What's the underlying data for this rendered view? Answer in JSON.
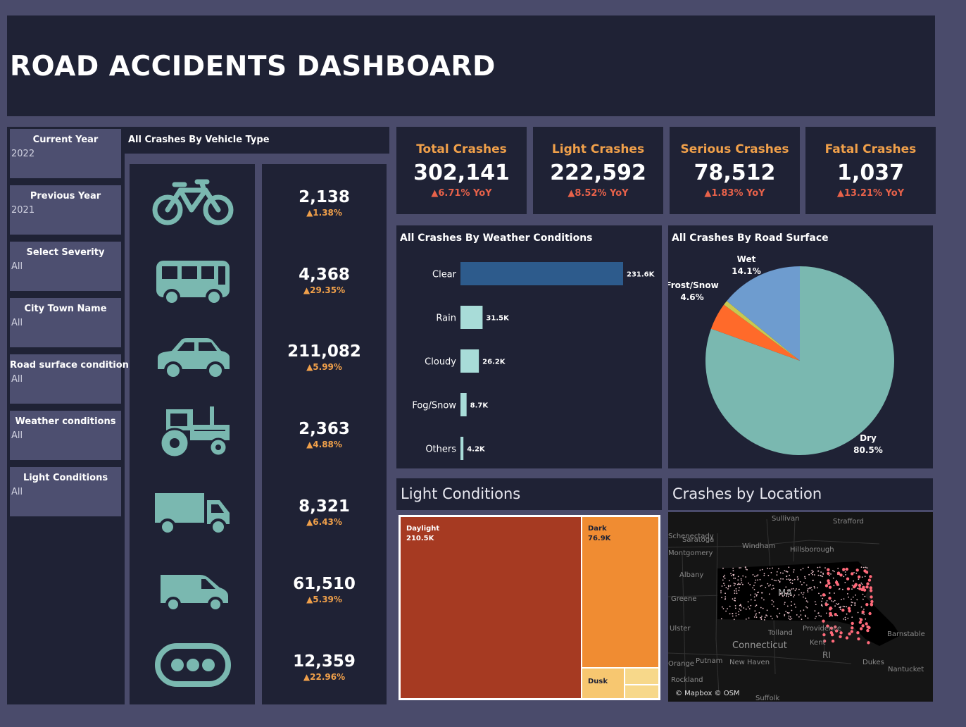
{
  "header": {
    "title": "ROAD ACCIDENTS DASHBOARD"
  },
  "filters": [
    {
      "label": "Current Year",
      "value": "2022"
    },
    {
      "label": "Previous Year",
      "value": "2021"
    },
    {
      "label": "Select Severity",
      "value": "All"
    },
    {
      "label": "City Town Name",
      "value": "All"
    },
    {
      "label": "Road surface condition",
      "value": "All"
    },
    {
      "label": "Weather conditions",
      "value": "All"
    },
    {
      "label": "Light Conditions",
      "value": "All"
    }
  ],
  "vehicle_section": {
    "title": "All Crashes By Vehicle Type",
    "items": [
      {
        "icon": "bicycle-icon",
        "value": "2,138",
        "change": "▲1.38%"
      },
      {
        "icon": "bus-icon",
        "value": "4,368",
        "change": "▲29.35%"
      },
      {
        "icon": "car-icon",
        "value": "211,082",
        "change": "▲5.99%"
      },
      {
        "icon": "tractor-icon",
        "value": "2,363",
        "change": "▲4.88%"
      },
      {
        "icon": "truck-icon",
        "value": "8,321",
        "change": "▲6.43%"
      },
      {
        "icon": "van-icon",
        "value": "61,510",
        "change": "▲5.39%"
      },
      {
        "icon": "others-icon",
        "value": "12,359",
        "change": "▲22.96%"
      }
    ]
  },
  "kpis": [
    {
      "label": "Total Crashes",
      "value": "302,141",
      "change": "▲6.71% YoY"
    },
    {
      "label": "Light Crashes",
      "value": "222,592",
      "change": "▲8.52% YoY"
    },
    {
      "label": "Serious Crashes",
      "value": "78,512",
      "change": "▲1.83% YoY"
    },
    {
      "label": "Fatal Crashes",
      "value": "1,037",
      "change": "▲13.21% YoY"
    }
  ],
  "colors": {
    "background": "#4a4b6b",
    "panel": "#1f2235",
    "accent_orange": "#f0a04a",
    "change_red": "#e8624a",
    "teal": "#7ab8b0"
  },
  "chart_data": [
    {
      "type": "bar",
      "title": "All Crashes By Weather Conditions",
      "orientation": "horizontal",
      "categories": [
        "Clear",
        "Rain",
        "Cloudy",
        "Fog/Snow",
        "Others"
      ],
      "values": [
        231600,
        31500,
        26200,
        8700,
        4200
      ],
      "labels": [
        "231.6K",
        "31.5K",
        "26.2K",
        "8.7K",
        "4.2K"
      ],
      "colors": [
        "#2d5b8c",
        "#a8dcd8",
        "#a8dcd8",
        "#a8dcd8",
        "#a8dcd8"
      ],
      "xlim": [
        0,
        231600
      ]
    },
    {
      "type": "pie",
      "title": "All Crashes By Road Surface",
      "slices": [
        {
          "label": "Dry",
          "value": 80.5,
          "label_text": "80.5%",
          "color": "#7ab8b0"
        },
        {
          "label": "Frost/Snow",
          "value": 4.6,
          "label_text": "4.6%",
          "color": "#ff6a2a"
        },
        {
          "label": "",
          "value": 0.8,
          "label_text": "",
          "color": "#c8c850"
        },
        {
          "label": "Wet",
          "value": 14.1,
          "label_text": "14.1%",
          "color": "#6e9ccf"
        }
      ]
    },
    {
      "type": "treemap",
      "title": "Light Conditions",
      "items": [
        {
          "label": "Daylight",
          "value_label": "210.5K",
          "value": 210500,
          "color": "#a63a22"
        },
        {
          "label": "Dark",
          "value_label": "76.9K",
          "value": 76900,
          "color": "#f08c32"
        },
        {
          "label": "Dusk",
          "value_label": "",
          "value": 9000,
          "color": "#f7c770"
        },
        {
          "label": "",
          "value_label": "",
          "value": 3000,
          "color": "#f7d88a"
        },
        {
          "label": "",
          "value_label": "",
          "value": 2500,
          "color": "#f7d88a"
        }
      ]
    }
  ],
  "map": {
    "title": "Crashes by Location",
    "credit": "© Mapbox © OSM",
    "place_labels": [
      "Sullivan",
      "Strafford",
      "Saratoga",
      "Windham",
      "Hillsborough",
      "Albany",
      "Greene",
      "Ulster",
      "Connecticut",
      "Tolland",
      "Providence",
      "Kent",
      "RI",
      "New Haven",
      "Putnam",
      "Rockland",
      "Orange",
      "Barnstable",
      "Nantucket",
      "Suffolk",
      "Montgomery",
      "Schenectady",
      "MA",
      "Dukes"
    ]
  }
}
